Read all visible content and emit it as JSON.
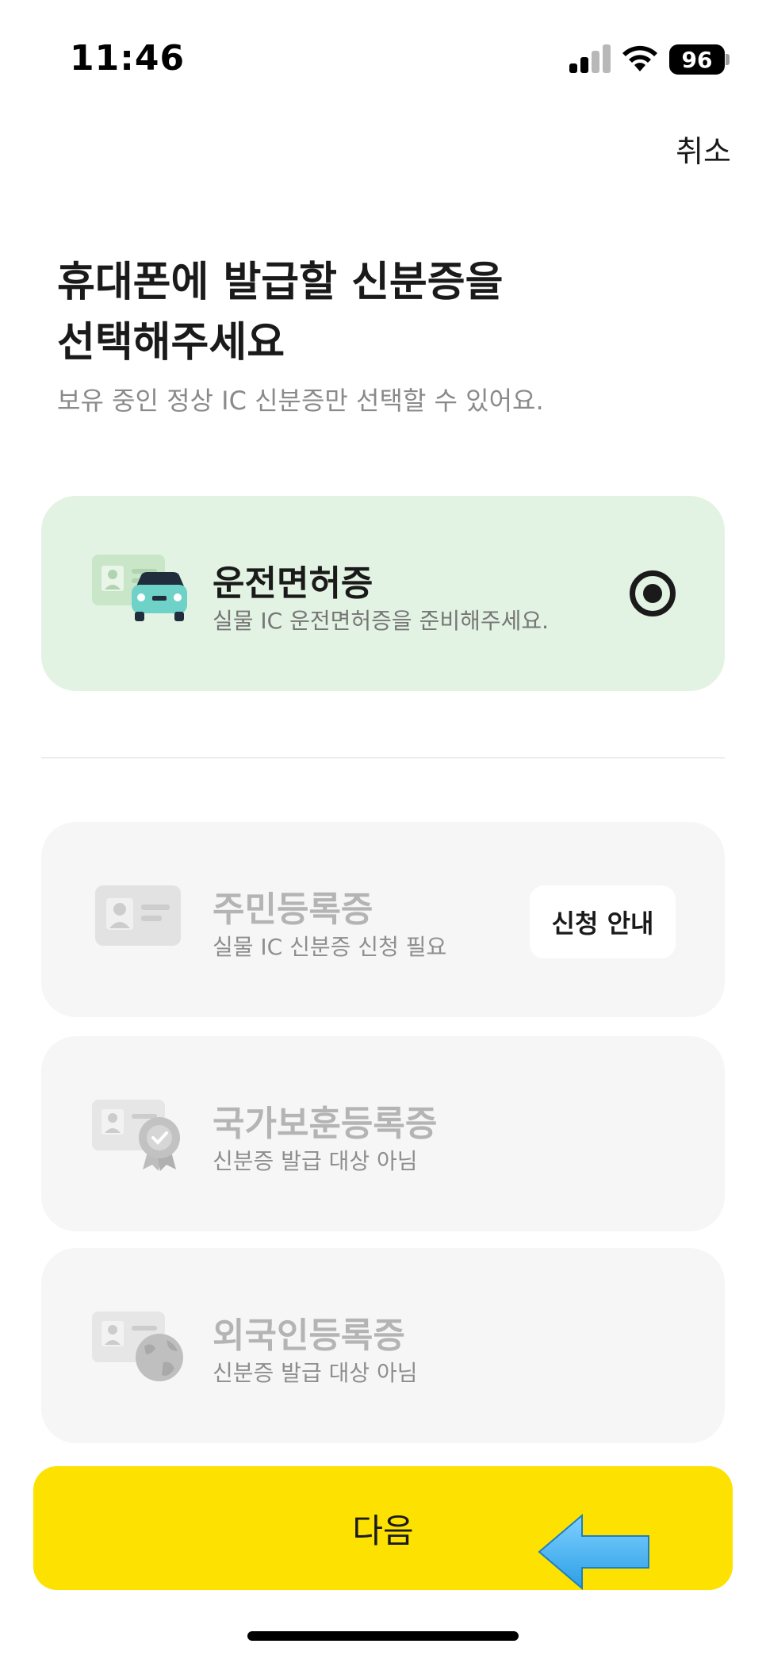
{
  "status_bar": {
    "time": "11:46",
    "battery": "96"
  },
  "header": {
    "cancel_label": "취소"
  },
  "intro": {
    "title_line1": "휴대폰에 발급할 신분증을",
    "title_line2": "선택해주세요",
    "subtitle": "보유 중인 정상 IC 신분증만 선택할 수 있어요."
  },
  "selected_id": {
    "name": "운전면허증",
    "description": "실물 IC 운전면허증을 준비해주세요.",
    "icon": "drivers-license-car-icon",
    "selected": true
  },
  "other_ids": [
    {
      "name": "주민등록증",
      "description": "실물 IC 신분증 신청 필요",
      "icon": "id-card-icon",
      "action_label": "신청 안내"
    },
    {
      "name": "국가보훈등록증",
      "description": "신분증 발급 대상 아님",
      "icon": "veteran-badge-icon"
    },
    {
      "name": "외국인등록증",
      "description": "신분증 발급 대상 아님",
      "icon": "globe-id-icon"
    }
  ],
  "footer": {
    "next_label": "다음"
  },
  "colors": {
    "accent_yellow": "#fde100",
    "selected_card_bg": "#e3f3e3",
    "disabled_card_bg": "#f6f6f6",
    "annotation_arrow": "#3db1f2"
  }
}
